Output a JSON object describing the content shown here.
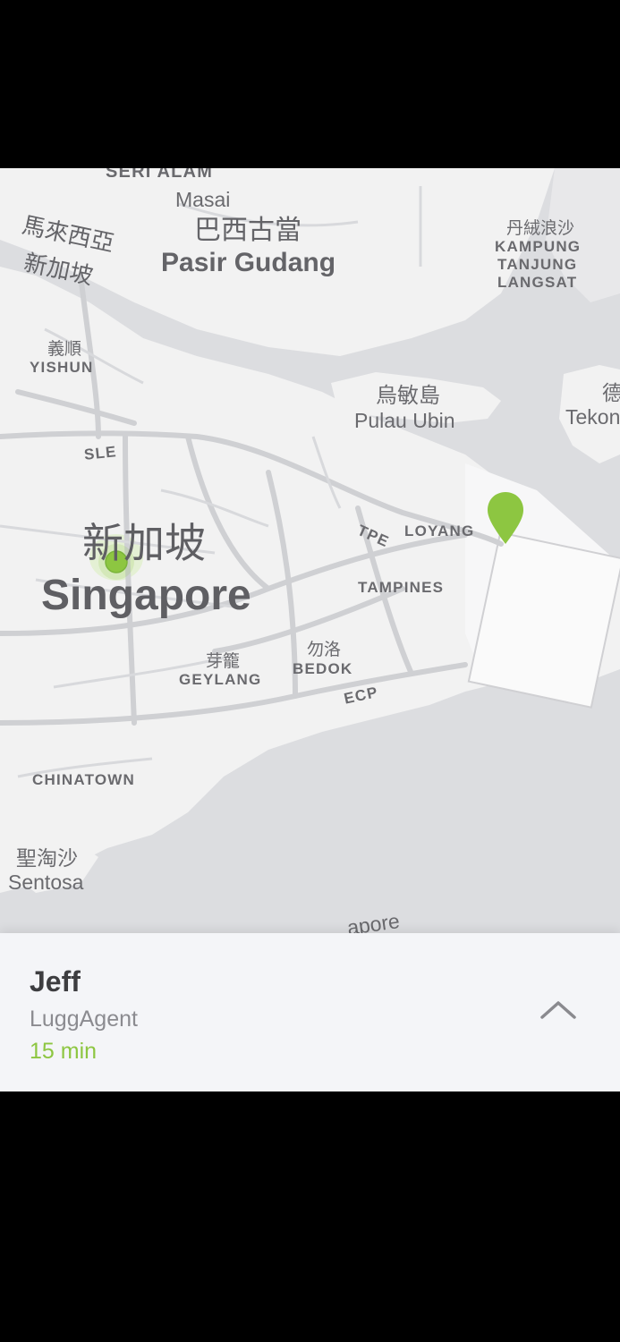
{
  "map": {
    "labels": {
      "seri_alam": "SERI ALAM",
      "masai": "Masai",
      "pasir_gudang_cjk": "巴西古當",
      "pasir_gudang": "Pasir Gudang",
      "malaysia_sg_cjk_1": "馬來西亞",
      "malaysia_sg_cjk_2": "新加坡",
      "kampung_cjk": "丹絨浪沙",
      "kampung_1": "KAMPUNG",
      "kampung_2": "TANJUNG",
      "kampung_3": "LANGSAT",
      "yishun_cjk": "義順",
      "yishun": "YISHUN",
      "pulau_ubin_cjk": "烏敏島",
      "pulau_ubin": "Pulau Ubin",
      "tekong_cjk": "德",
      "tekong": "Tekon",
      "sle": "SLE",
      "tpe": "TPE",
      "loyang": "LOYANG",
      "singapore_cjk": "新加坡",
      "singapore": "Singapore",
      "tampines": "TAMPINES",
      "geylang_cjk": "芽籠",
      "geylang": "GEYLANG",
      "bedok_cjk": "勿洛",
      "bedok": "BEDOK",
      "ecp": "ECP",
      "chinatown": "CHINATOWN",
      "sentosa_cjk": "聖淘沙",
      "sentosa": "Sentosa",
      "singapore_strait": "apore"
    },
    "colors": {
      "land": "#f2f2f2",
      "water": "#dcdde0",
      "road": "#cfd0d3",
      "marker": "#8dc641"
    }
  },
  "agent": {
    "name": "Jeff",
    "role": "LuggAgent",
    "eta": "15 min"
  },
  "icons": {
    "expand": "chevron-up-icon",
    "destination": "map-pin-icon",
    "current": "location-dot-icon"
  }
}
